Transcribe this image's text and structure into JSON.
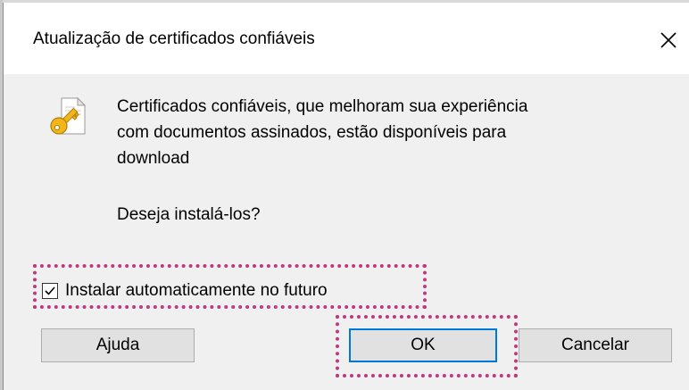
{
  "dialog": {
    "title": "Atualização de certificados confiáveis",
    "message": "Certificados confiáveis, que melhoram sua experiência\ncom documentos assinados, estão disponíveis para\ndownload",
    "question": "Deseja instalá-los?",
    "checkbox": {
      "label": "Instalar automaticamente no futuro",
      "checked": true
    },
    "buttons": {
      "help": "Ajuda",
      "ok": "OK",
      "cancel": "Cancelar"
    },
    "icons": {
      "close": "close-icon",
      "key": "certificate-key-icon",
      "check": "checkmark-icon"
    },
    "colors": {
      "highlight": "#c0387e",
      "focus": "#0078d7",
      "key": "#f2b619"
    }
  }
}
